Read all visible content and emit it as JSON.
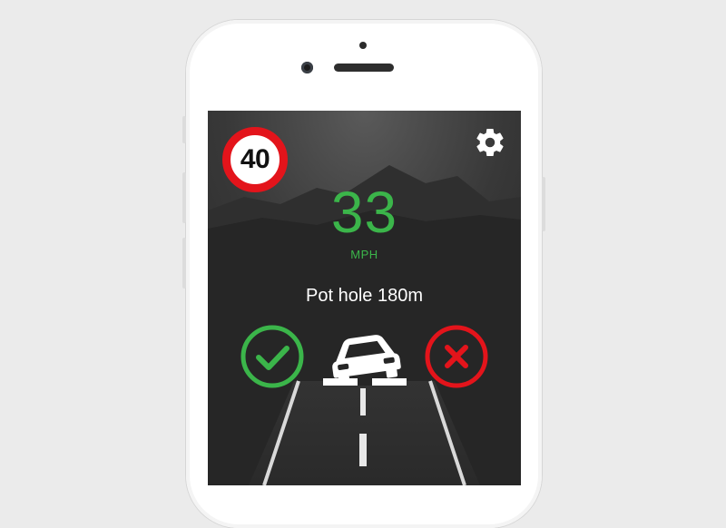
{
  "speed_limit": {
    "value": "40",
    "ring_color": "#e3141b"
  },
  "speed": {
    "value": "33",
    "unit": "MPH",
    "color": "#3bb54a"
  },
  "hazard": {
    "text": "Pot hole 180m",
    "icon": "car-pothole-icon"
  },
  "actions": {
    "confirm": {
      "icon": "checkmark-icon",
      "color": "#3bb54a"
    },
    "dismiss": {
      "icon": "cross-icon",
      "color": "#e3141b"
    }
  },
  "toolbar": {
    "settings_icon": "gear-icon"
  }
}
